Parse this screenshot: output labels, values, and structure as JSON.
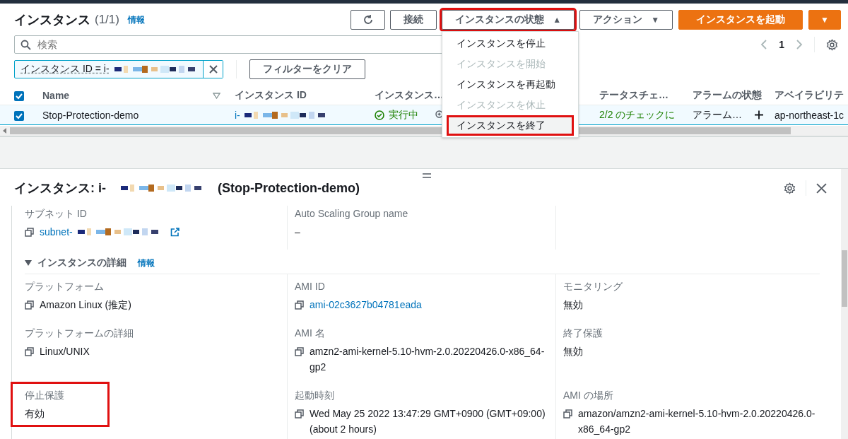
{
  "header": {
    "title": "インスタンス",
    "count": "(1/1)",
    "info": "情報"
  },
  "toolbar": [
    {
      "kind": "refresh"
    },
    {
      "kind": "button",
      "label": "接続"
    },
    {
      "kind": "dropdown",
      "label": "インスタンスの状態",
      "caret": "▲",
      "highlighted": true,
      "menu": [
        {
          "label": "インスタンスを停止",
          "disabled": false,
          "hovered": false,
          "highlighted": false
        },
        {
          "label": "インスタンスを開始",
          "disabled": true,
          "hovered": false,
          "highlighted": false
        },
        {
          "label": "インスタンスを再起動",
          "disabled": false,
          "hovered": false,
          "highlighted": false
        },
        {
          "label": "インスタンスを休止",
          "disabled": true,
          "hovered": false,
          "highlighted": false
        },
        {
          "label": "インスタンスを終了",
          "disabled": false,
          "hovered": true,
          "highlighted": true
        }
      ]
    },
    {
      "kind": "dropdown",
      "label": "アクション",
      "caret": "▼",
      "highlighted": false
    },
    {
      "kind": "primary",
      "label": "インスタンスを起動"
    },
    {
      "kind": "primary-caret",
      "caret": "▼"
    }
  ],
  "search": {
    "placeholder": "検索"
  },
  "pagination": {
    "page": "1"
  },
  "filter": {
    "token": "インスタンス ID = i-",
    "clear": "フィルターをクリア"
  },
  "table": {
    "all_checked": true,
    "columns": [
      {
        "label": "Name",
        "sortable": true
      },
      {
        "label": "インスタンス ID"
      },
      {
        "label": "インスタンス…"
      },
      {
        "label": "テータスチェ…"
      },
      {
        "label": "アラームの状態"
      },
      {
        "label": "アベイラビリテ"
      }
    ],
    "rows": [
      {
        "checked": true,
        "selected": true,
        "name": "Stop-Protection-demo",
        "id": "i-",
        "state": "実行中",
        "status_check": "2/2 のチェックに",
        "alarm": "アラーム…",
        "az": "ap-northeast-1c"
      }
    ]
  },
  "details": {
    "title": "インスタンス: i-",
    "name": "(Stop-Protection-demo)",
    "top_rows": [
      [
        {
          "label": "サブネット ID",
          "value": "subnet-",
          "kind": "copy-link-masked",
          "highlighted": false
        },
        {
          "label": "Auto Scaling Group name",
          "value": "–",
          "kind": "text",
          "highlighted": false
        }
      ]
    ],
    "section": {
      "title": "インスタンスの詳細",
      "info": "情報",
      "expanded": true
    },
    "rows": [
      [
        {
          "label": "プラットフォーム",
          "value": "Amazon Linux (推定)",
          "kind": "copy",
          "highlighted": false
        },
        {
          "label": "AMI ID",
          "value": "ami-02c3627b04781eada",
          "kind": "copy-link",
          "highlighted": false
        },
        {
          "label": "モニタリング",
          "value": "無効",
          "kind": "text",
          "highlighted": false
        }
      ],
      [
        {
          "label": "プラットフォームの詳細",
          "value": "Linux/UNIX",
          "kind": "copy",
          "highlighted": false
        },
        {
          "label": "AMI 名",
          "value": "amzn2-ami-kernel-5.10-hvm-2.0.20220426.0-x86_64-gp2",
          "kind": "copy",
          "highlighted": false
        },
        {
          "label": "終了保護",
          "value": "無効",
          "kind": "text",
          "highlighted": false
        }
      ],
      [
        {
          "label": "停止保護",
          "value": "有効",
          "kind": "text",
          "highlighted": true
        },
        {
          "label": "起動時刻",
          "value": "Wed May 25 2022 13:47:29 GMT+0900 (GMT+09:00) (about 2 hours)",
          "kind": "copy",
          "highlighted": false
        },
        {
          "label": "AMI の場所",
          "value": "amazon/amzn2-ami-kernel-5.10-hvm-2.0.20220426.0-x86_64-gp2",
          "kind": "copy",
          "highlighted": false
        }
      ]
    ]
  }
}
